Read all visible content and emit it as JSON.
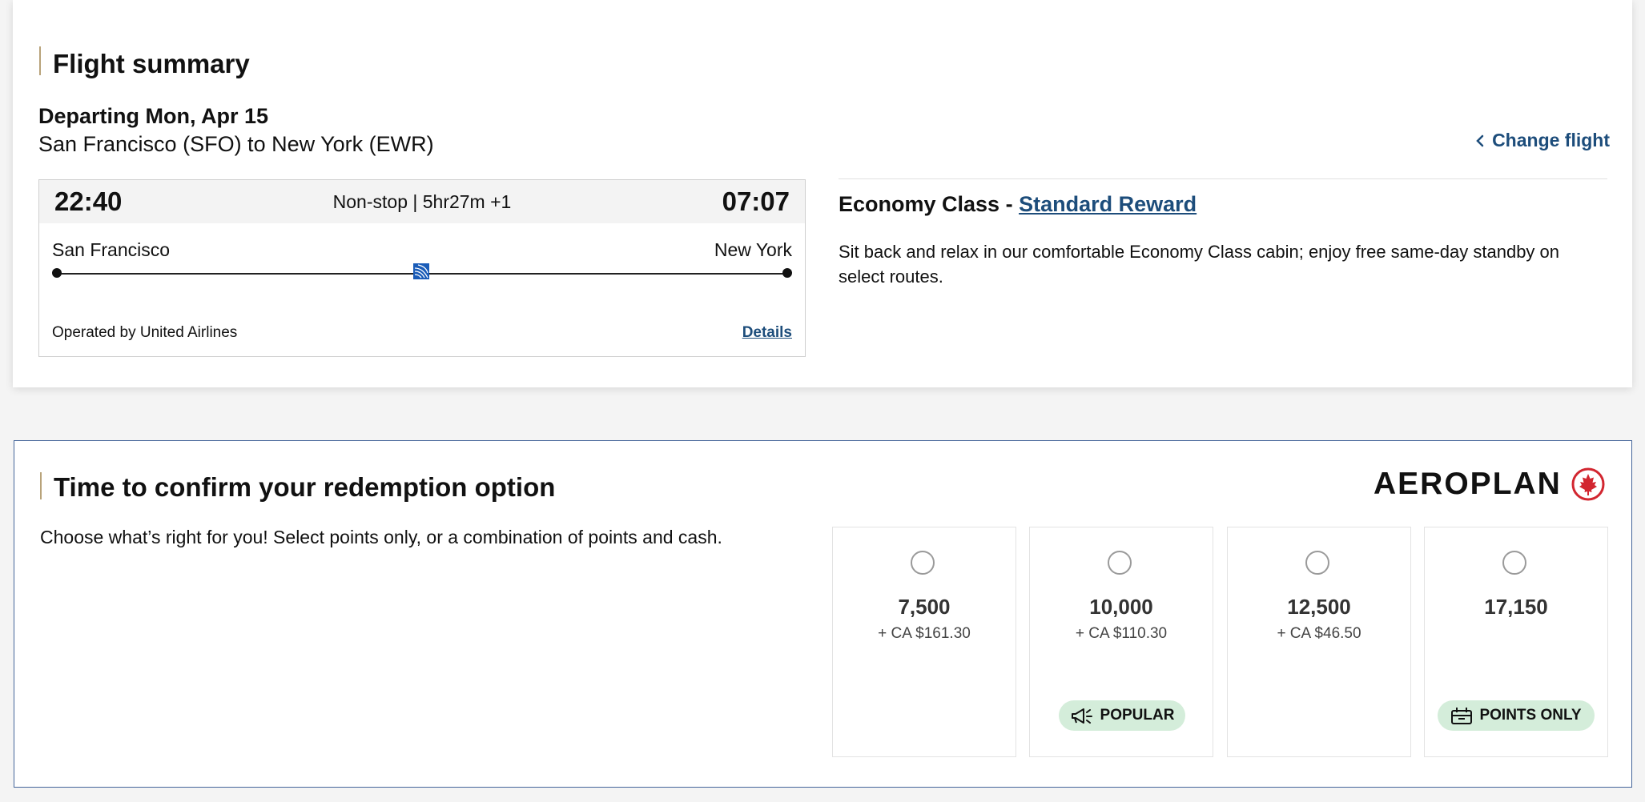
{
  "summary": {
    "title": "Flight summary",
    "departing": "Departing Mon, Apr 15",
    "route": "San Francisco (SFO) to New York (EWR)",
    "change_flight": "Change flight",
    "flight": {
      "depart_time": "22:40",
      "info": "Non-stop | 5hr27m +1",
      "arrive_time": "07:07",
      "origin_city": "San Francisco",
      "destination_city": "New York",
      "operated_by": "Operated by United Airlines",
      "details_link": "Details"
    },
    "fare": {
      "class_label": "Economy Class -",
      "fare_link": "Standard Reward",
      "description_line1": "Sit back and relax in our comfortable Economy Class cabin; enjoy free same-day standby on",
      "description_line2": "select routes."
    }
  },
  "redemption": {
    "title": "Time to confirm your redemption option",
    "subtitle": "Choose what’s right for you! Select points only, or a combination of points and cash.",
    "brand": "AEROPLAN",
    "options": [
      {
        "points": "7,500",
        "cash": "+ CA $161.30",
        "badge": ""
      },
      {
        "points": "10,000",
        "cash": "+ CA $110.30",
        "badge": "POPULAR"
      },
      {
        "points": "12,500",
        "cash": "+ CA $46.50",
        "badge": ""
      },
      {
        "points": "17,150",
        "cash": "",
        "badge": "POINTS ONLY"
      }
    ]
  },
  "colors": {
    "link": "#1d4d7b",
    "accent": "#b8a37a",
    "badge_bg": "#d4edda",
    "brand_red": "#d22630",
    "card_border": "#44659a"
  }
}
